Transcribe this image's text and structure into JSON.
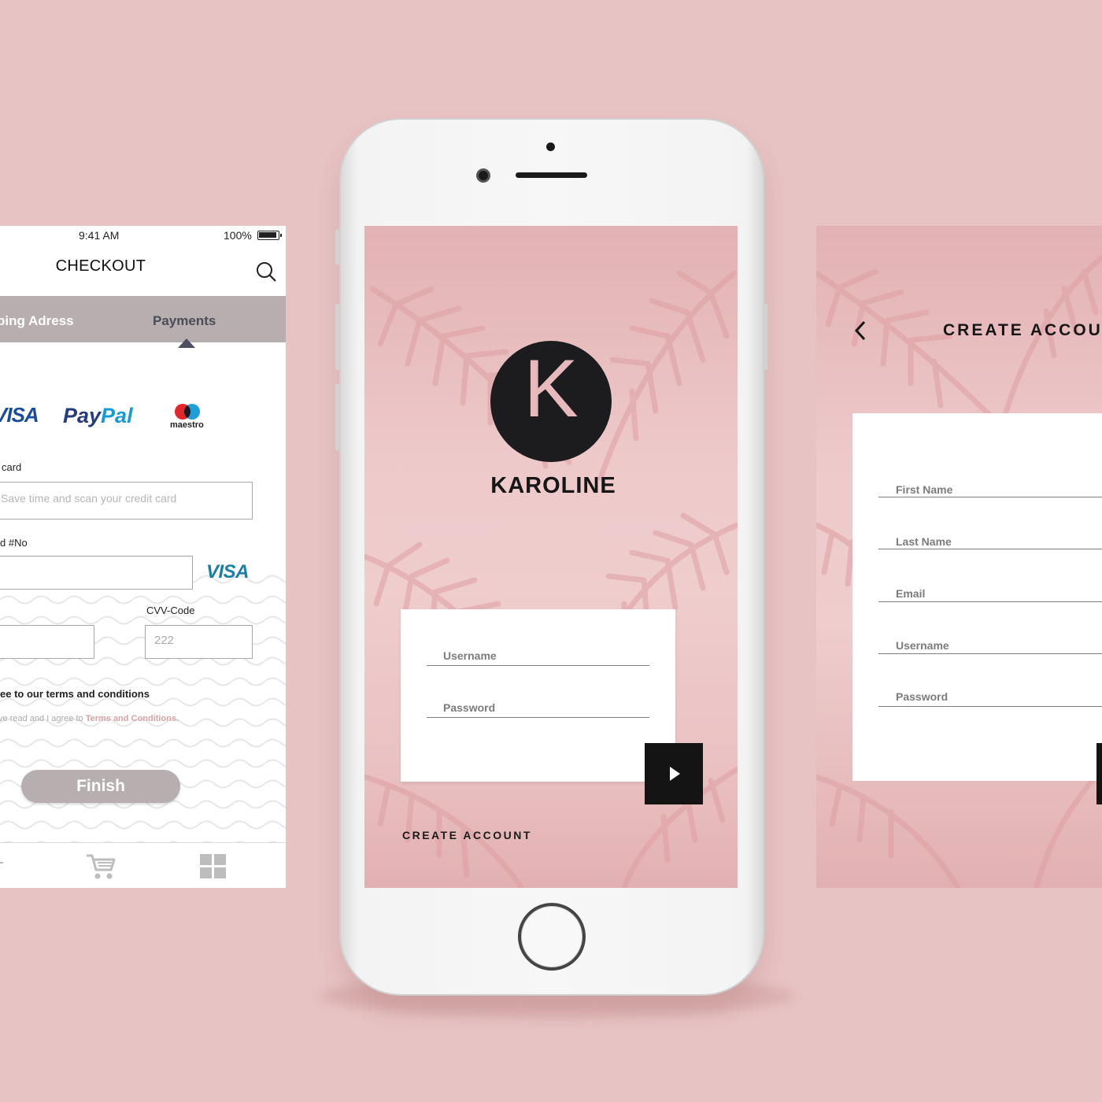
{
  "checkout": {
    "status": {
      "time": "9:41 AM",
      "battery": "100%"
    },
    "title": "CHECKOUT",
    "tabs": [
      {
        "label": "ping Adress"
      },
      {
        "label": "Payments"
      }
    ],
    "payment_methods": {
      "visa": "VISA",
      "paypal_a": "Pay",
      "paypal_b": "Pal",
      "maestro": "maestro"
    },
    "scan_label": "card",
    "scan_placeholder": "Save time and scan your credit card",
    "card_no_label": "d #No",
    "card_brand": "VISA",
    "cvv_label": "CVV-Code",
    "cvv_value": "222",
    "terms_title": "ee to our terms and conditions",
    "terms_prefix": "ve read and I agree to ",
    "terms_link": "Terms and Conditions.",
    "finish_label": "Finish"
  },
  "login": {
    "logo_letter": "K",
    "brand": "KAROLINE",
    "username_label": "Username",
    "password_label": "Password",
    "create_account": "CREATE ACCOUNT"
  },
  "create_account": {
    "title": "CREATE ACCOU",
    "fields": [
      "First Name",
      "Last Name",
      "Email",
      "Username",
      "Password"
    ]
  },
  "colors": {
    "background": "#e8c3c4",
    "tab_bar": "#b7aeaf",
    "finish_button": "#b6aeaf",
    "accent_pink": "#d7a3a6",
    "dark": "#141414"
  }
}
